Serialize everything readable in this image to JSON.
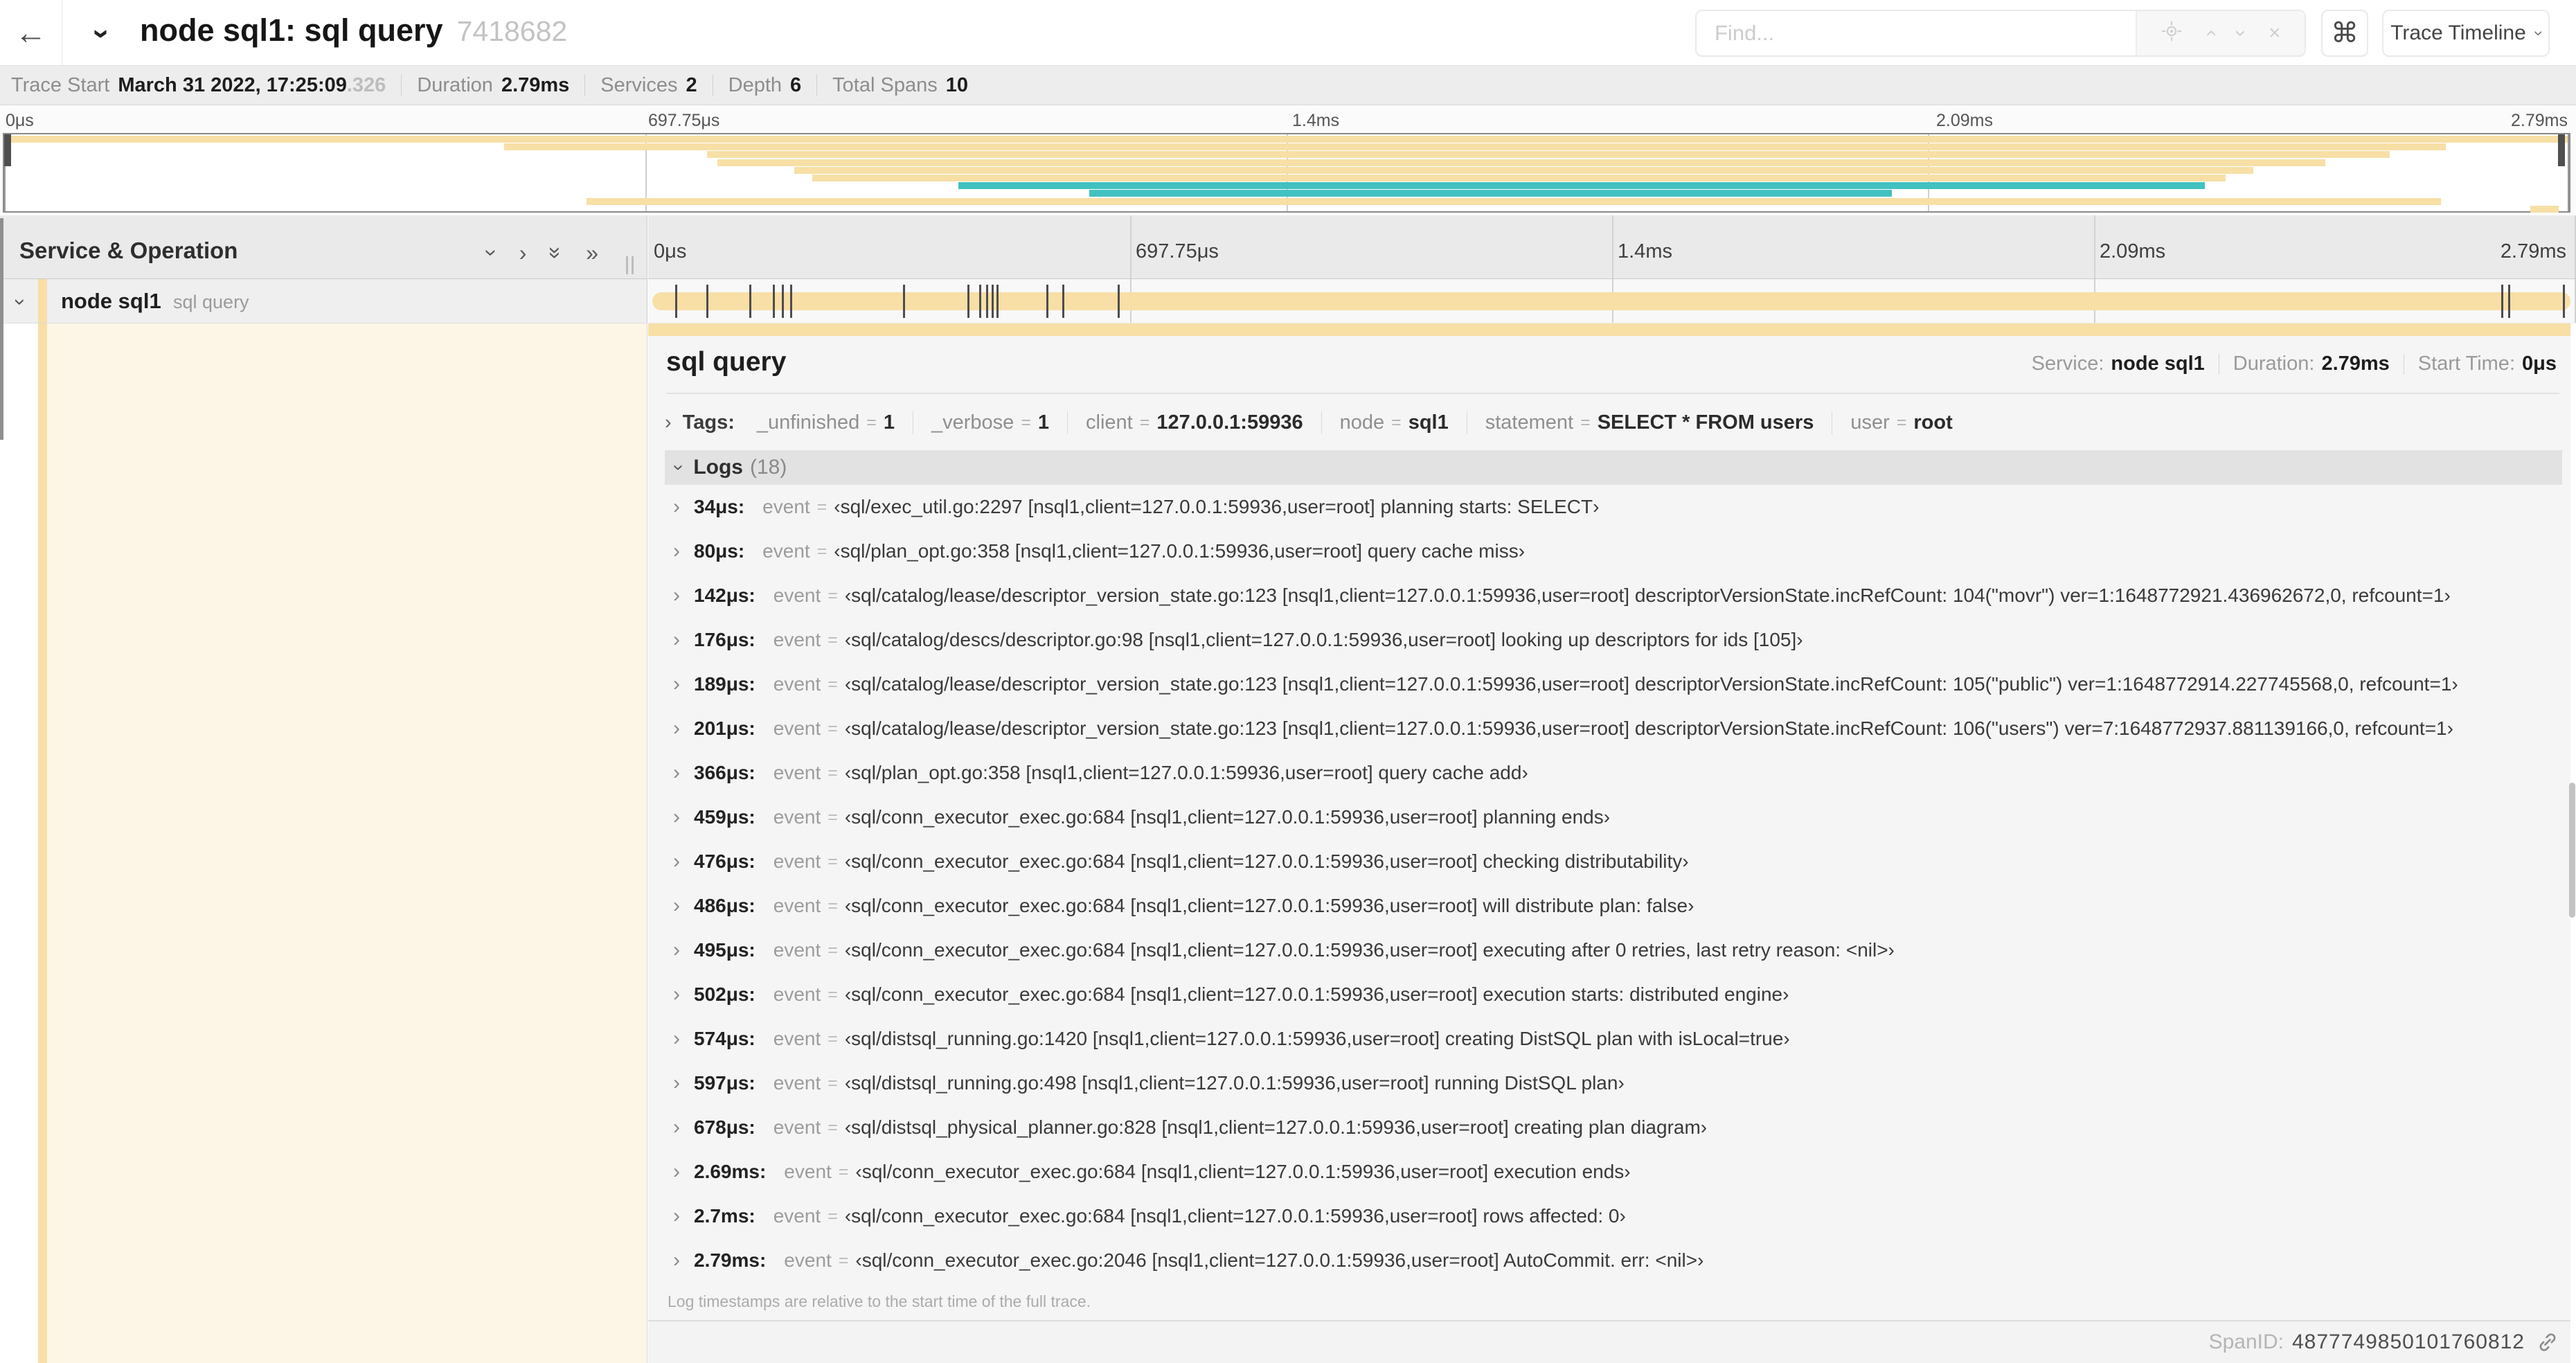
{
  "colors": {
    "tan": "#f7dfa6",
    "teal": "#41c1c0",
    "cream": "#fdf6e7"
  },
  "header": {
    "back_icon": "←",
    "title": "node sql1: sql query",
    "trace_id": "7418682",
    "find_placeholder": "Find...",
    "cmd_icon": "⌘",
    "view_dropdown": "Trace Timeline"
  },
  "meta_bar": {
    "trace_start": {
      "label": "Trace Start",
      "value": "March 31 2022, 17:25:09",
      "fraction": ".326"
    },
    "duration": {
      "label": "Duration",
      "value": "2.79ms"
    },
    "services": {
      "label": "Services",
      "value": "2"
    },
    "depth": {
      "label": "Depth",
      "value": "6"
    },
    "total_spans": {
      "label": "Total Spans",
      "value": "10"
    }
  },
  "minimap": {
    "ticks": [
      "0μs",
      "697.75μs",
      "1.4ms",
      "2.09ms",
      "2.79ms"
    ],
    "bars": [
      {
        "start": 0.0,
        "end": 1.0,
        "color": "tan"
      },
      {
        "start": 0.195,
        "end": 0.952,
        "color": "tan"
      },
      {
        "start": 0.274,
        "end": 0.93,
        "color": "tan"
      },
      {
        "start": 0.278,
        "end": 0.905,
        "color": "tan"
      },
      {
        "start": 0.308,
        "end": 0.877,
        "color": "tan"
      },
      {
        "start": 0.315,
        "end": 0.866,
        "color": "tan"
      },
      {
        "start": 0.372,
        "end": 0.858,
        "color": "teal"
      },
      {
        "start": 0.423,
        "end": 0.736,
        "color": "teal"
      },
      {
        "start": 0.227,
        "end": 0.95,
        "color": "tan"
      },
      {
        "start": 0.985,
        "end": 0.996,
        "color": "tan"
      }
    ]
  },
  "timeline": {
    "left_header": "Service & Operation",
    "ticks": [
      "0μs",
      "697.75μs",
      "1.4ms",
      "2.09ms",
      "2.79ms"
    ],
    "span_row": {
      "service": "node sql1",
      "operation": "sql query",
      "duration_us": 2790,
      "log_marks_us": [
        34,
        80,
        142,
        176,
        189,
        201,
        366,
        459,
        476,
        486,
        495,
        502,
        574,
        597,
        678,
        2690,
        2700,
        2790
      ]
    }
  },
  "detail": {
    "title": "sql query",
    "service": {
      "label": "Service:",
      "value": "node sql1"
    },
    "duration": {
      "label": "Duration:",
      "value": "2.79ms"
    },
    "start_time": {
      "label": "Start Time:",
      "value": "0μs"
    },
    "tags_label": "Tags:",
    "tags": [
      {
        "key": "_unfinished",
        "value": "1"
      },
      {
        "key": "_verbose",
        "value": "1"
      },
      {
        "key": "client",
        "value": "127.0.0.1:59936"
      },
      {
        "key": "node",
        "value": "sql1"
      },
      {
        "key": "statement",
        "value": "SELECT * FROM users"
      },
      {
        "key": "user",
        "value": "root"
      }
    ],
    "logs_title": "Logs",
    "logs_count": "(18)",
    "logs": [
      {
        "time": "34μs:",
        "key": "event",
        "value": "‹sql/exec_util.go:2297 [nsql1,client=127.0.0.1:59936,user=root] planning starts: SELECT›"
      },
      {
        "time": "80μs:",
        "key": "event",
        "value": "‹sql/plan_opt.go:358 [nsql1,client=127.0.0.1:59936,user=root] query cache miss›"
      },
      {
        "time": "142μs:",
        "key": "event",
        "value": "‹sql/catalog/lease/descriptor_version_state.go:123 [nsql1,client=127.0.0.1:59936,user=root] descriptorVersionState.incRefCount: 104(\"movr\") ver=1:1648772921.436962672,0, refcount=1›"
      },
      {
        "time": "176μs:",
        "key": "event",
        "value": "‹sql/catalog/descs/descriptor.go:98 [nsql1,client=127.0.0.1:59936,user=root] looking up descriptors for ids [105]›"
      },
      {
        "time": "189μs:",
        "key": "event",
        "value": "‹sql/catalog/lease/descriptor_version_state.go:123 [nsql1,client=127.0.0.1:59936,user=root] descriptorVersionState.incRefCount: 105(\"public\") ver=1:1648772914.227745568,0, refcount=1›"
      },
      {
        "time": "201μs:",
        "key": "event",
        "value": "‹sql/catalog/lease/descriptor_version_state.go:123 [nsql1,client=127.0.0.1:59936,user=root] descriptorVersionState.incRefCount: 106(\"users\") ver=7:1648772937.881139166,0, refcount=1›"
      },
      {
        "time": "366μs:",
        "key": "event",
        "value": "‹sql/plan_opt.go:358 [nsql1,client=127.0.0.1:59936,user=root] query cache add›"
      },
      {
        "time": "459μs:",
        "key": "event",
        "value": "‹sql/conn_executor_exec.go:684 [nsql1,client=127.0.0.1:59936,user=root] planning ends›"
      },
      {
        "time": "476μs:",
        "key": "event",
        "value": "‹sql/conn_executor_exec.go:684 [nsql1,client=127.0.0.1:59936,user=root] checking distributability›"
      },
      {
        "time": "486μs:",
        "key": "event",
        "value": "‹sql/conn_executor_exec.go:684 [nsql1,client=127.0.0.1:59936,user=root] will distribute plan: false›"
      },
      {
        "time": "495μs:",
        "key": "event",
        "value": "‹sql/conn_executor_exec.go:684 [nsql1,client=127.0.0.1:59936,user=root] executing after 0 retries, last retry reason: <nil>›"
      },
      {
        "time": "502μs:",
        "key": "event",
        "value": "‹sql/conn_executor_exec.go:684 [nsql1,client=127.0.0.1:59936,user=root] execution starts: distributed engine›"
      },
      {
        "time": "574μs:",
        "key": "event",
        "value": "‹sql/distsql_running.go:1420 [nsql1,client=127.0.0.1:59936,user=root] creating DistSQL plan with isLocal=true›"
      },
      {
        "time": "597μs:",
        "key": "event",
        "value": "‹sql/distsql_running.go:498 [nsql1,client=127.0.0.1:59936,user=root] running DistSQL plan›"
      },
      {
        "time": "678μs:",
        "key": "event",
        "value": "‹sql/distsql_physical_planner.go:828 [nsql1,client=127.0.0.1:59936,user=root] creating plan diagram›"
      },
      {
        "time": "2.69ms:",
        "key": "event",
        "value": "‹sql/conn_executor_exec.go:684 [nsql1,client=127.0.0.1:59936,user=root] execution ends›"
      },
      {
        "time": "2.7ms:",
        "key": "event",
        "value": "‹sql/conn_executor_exec.go:684 [nsql1,client=127.0.0.1:59936,user=root] rows affected: 0›"
      },
      {
        "time": "2.79ms:",
        "key": "event",
        "value": "‹sql/conn_executor_exec.go:2046 [nsql1,client=127.0.0.1:59936,user=root] AutoCommit. err: <nil>›"
      }
    ],
    "footer_note": "Log timestamps are relative to the start time of the full trace.",
    "span_id": {
      "label": "SpanID:",
      "value": "4877749850101760812"
    }
  }
}
